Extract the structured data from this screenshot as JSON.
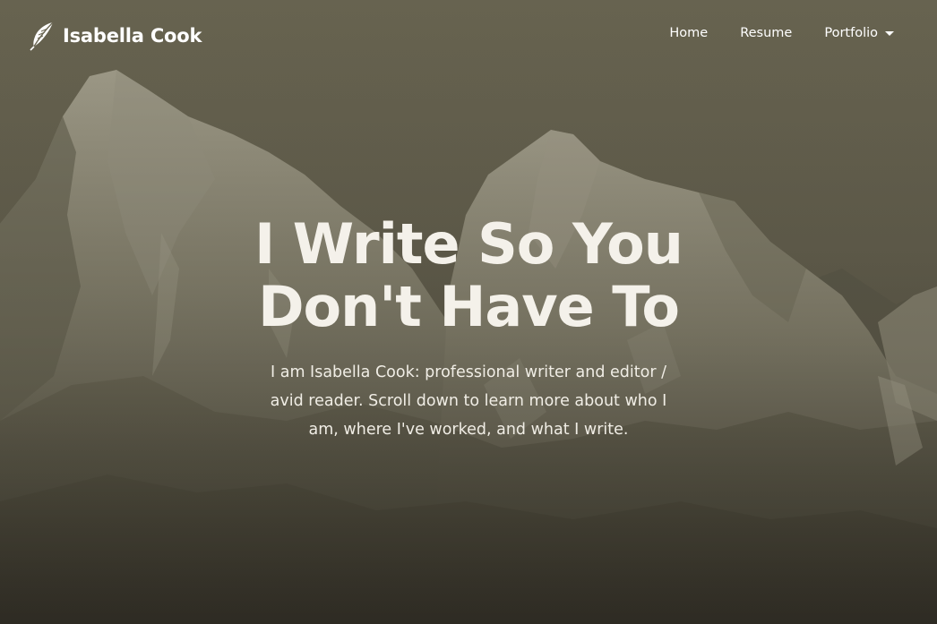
{
  "brand": {
    "name": "Isabella Cook",
    "icon": "feather-quill-icon"
  },
  "nav": {
    "items": [
      {
        "label": "Home"
      },
      {
        "label": "Resume"
      },
      {
        "label": "Portfolio",
        "has_dropdown": true
      }
    ]
  },
  "hero": {
    "title": "I Write So You Don't Have To",
    "subtitle": "I am Isabella Cook: professional writer and editor / avid reader. Scroll down to learn more about who I am, where I've worked, and what I write."
  },
  "colors": {
    "overlay_tint": "#67634f",
    "text": "#ffffff",
    "title_text": "#f4f1ea"
  }
}
